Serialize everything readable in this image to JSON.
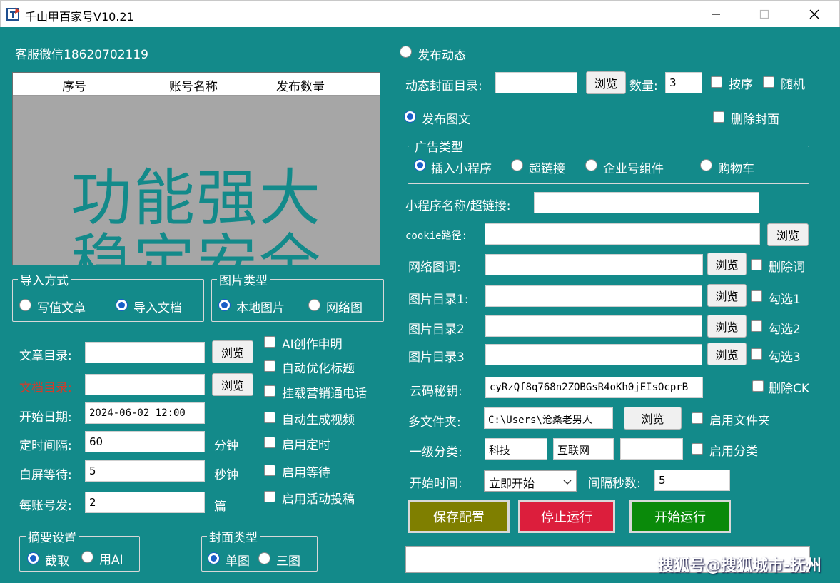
{
  "window": {
    "title": "千山甲百家号V10.21"
  },
  "service_contact": "客服微信18620702119",
  "grid": {
    "columns": [
      "序号",
      "账号名称",
      "发布数量"
    ],
    "banner_line1": "功能强大",
    "banner_line2": "稳定安全"
  },
  "import_group": {
    "title": "导入方式",
    "opt_write": "写值文章",
    "opt_import": "导入文档"
  },
  "image_type_group": {
    "title": "图片类型",
    "opt_local": "本地图片",
    "opt_web": "网络图"
  },
  "left_form": {
    "article_dir_label": "文章目录:",
    "doc_dir_label": "文档目录:",
    "start_date_label": "开始日期:",
    "start_date_value": "2024-06-02 12:00",
    "interval_label": "定时间隔:",
    "interval_value": "60",
    "interval_unit": "分钟",
    "wait_label": "白屏等待:",
    "wait_value": "5",
    "wait_unit": "秒钟",
    "per_account_label": "每账号发:",
    "per_account_value": "2",
    "per_account_unit": "篇",
    "browse": "浏览"
  },
  "left_checks": {
    "ai_declare": "AI创作申明",
    "auto_title": "自动优化标题",
    "mount_phone": "挂载营销通电话",
    "auto_video": "自动生成视频",
    "enable_timer": "启用定时",
    "enable_wait": "启用等待",
    "enable_activity": "启用活动投稿"
  },
  "summary_group": {
    "title": "摘要设置",
    "opt_cut": "截取",
    "opt_ai": "用AI"
  },
  "cover_group": {
    "title": "封面类型",
    "opt_single": "单图",
    "opt_three": "三图"
  },
  "right": {
    "publish_dynamic": "发布动态",
    "dynamic_cover_label": "动态封面目录:",
    "count_label": "数量:",
    "count_value": "3",
    "in_order": "按序",
    "random": "随机",
    "publish_article": "发布图文",
    "delete_cover": "删除封面",
    "ad_group_title": "广告类型",
    "ad_mini": "插入小程序",
    "ad_link": "超链接",
    "ad_component": "企业号组件",
    "ad_cart": "购物车",
    "mini_label": "小程序名称/超链接:",
    "cookie_label": "cookie路径:",
    "web_words_label": "网络图词:",
    "delete_words": "删除词",
    "img_dir1_label": "图片目录1:",
    "img_dir2_label": "图片目录2",
    "img_dir3_label": "图片目录3",
    "check1": "勾选1",
    "check2": "勾选2",
    "check3": "勾选3",
    "cloud_key_label": "云码秘钥:",
    "cloud_key_value": "cyRzQf8q768n2ZOBGsR4oKh0jEIsOcprB",
    "delete_ck": "删除CK",
    "multi_folder_label": "多文件夹:",
    "multi_folder_value": "C:\\Users\\沧桑老男人",
    "enable_folder": "启用文件夹",
    "category_label": "一级分类:",
    "category1": "科技",
    "category2": "互联网",
    "enable_category": "启用分类",
    "start_time_label": "开始时间:",
    "start_time_value": "立即开始",
    "interval_sec_label": "间隔秒数:",
    "interval_sec_value": "5",
    "browse": "浏览"
  },
  "actions": {
    "save": "保存配置",
    "stop": "停止运行",
    "start": "开始运行"
  },
  "watermark": "搜狐号@搜狐城市-抚州",
  "colors": {
    "background": "#138a8a",
    "save": "#7f7f00",
    "stop": "#dc1e3c",
    "start": "#0a8a0a",
    "radio_on": "#1a5ec8"
  }
}
